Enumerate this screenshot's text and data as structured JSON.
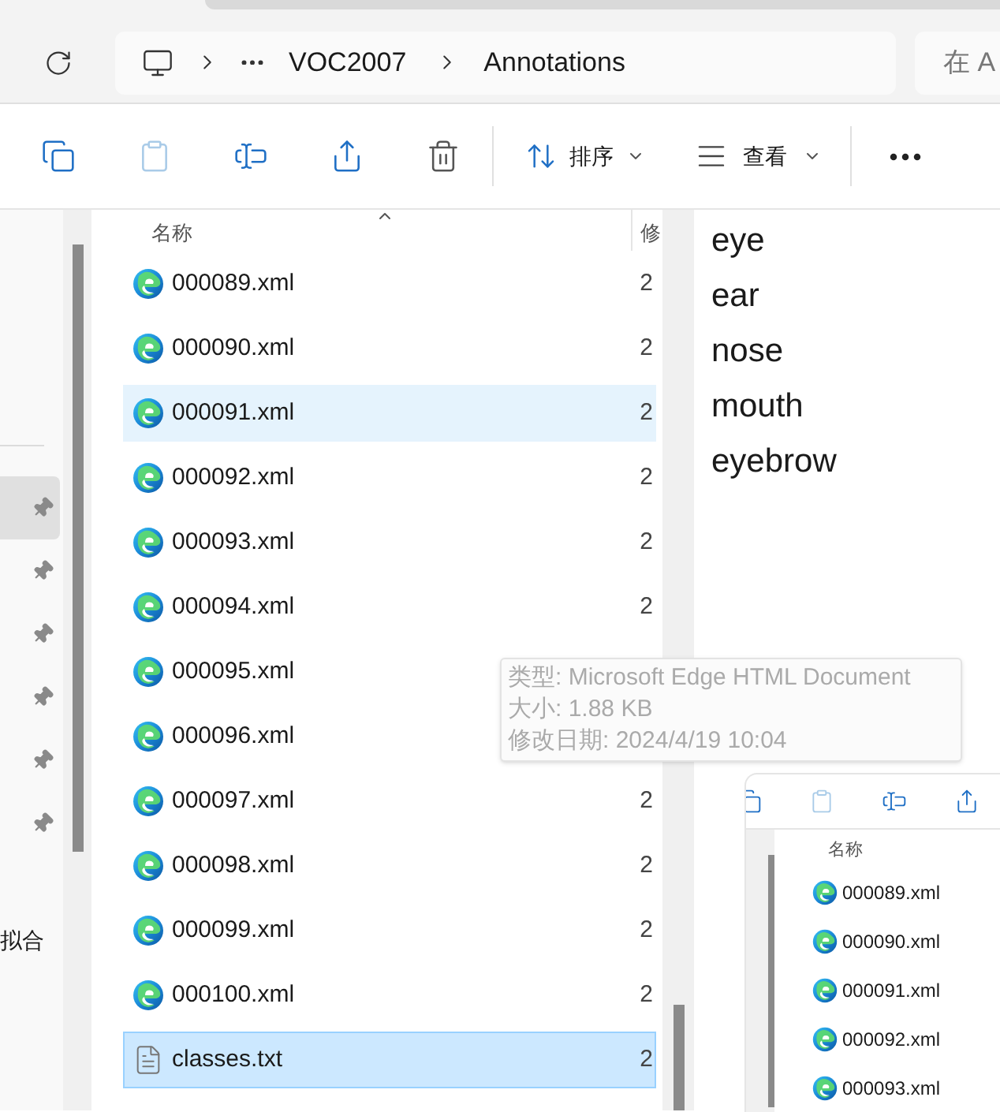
{
  "address_bar": {
    "breadcrumbs": [
      "VOC2007",
      "Annotations"
    ]
  },
  "search": {
    "placeholder": "在 A"
  },
  "toolbar": {
    "buttons": [
      {
        "kind": "copy",
        "disabled": false
      },
      {
        "kind": "paste",
        "disabled": true
      },
      {
        "kind": "rename",
        "disabled": false
      },
      {
        "kind": "share",
        "disabled": false
      },
      {
        "kind": "delete",
        "disabled": false
      }
    ],
    "sort": {
      "label": "排序"
    },
    "view": {
      "label": "查看"
    }
  },
  "nav": {
    "items": [
      {
        "selected": true
      },
      {
        "selected": false
      },
      {
        "selected": false
      },
      {
        "selected": false
      },
      {
        "selected": false
      },
      {
        "selected": false
      }
    ],
    "label": "拟合"
  },
  "file_list": {
    "columns": [
      "名称",
      "修"
    ],
    "files": [
      {
        "name": "000089.xml",
        "kind": "xml",
        "date": "2",
        "hovered": false,
        "selected": false
      },
      {
        "name": "000090.xml",
        "kind": "xml",
        "date": "2",
        "hovered": false,
        "selected": false
      },
      {
        "name": "000091.xml",
        "kind": "xml",
        "date": "2",
        "hovered": true,
        "selected": false
      },
      {
        "name": "000092.xml",
        "kind": "xml",
        "date": "2",
        "hovered": false,
        "selected": false
      },
      {
        "name": "000093.xml",
        "kind": "xml",
        "date": "2",
        "hovered": false,
        "selected": false
      },
      {
        "name": "000094.xml",
        "kind": "xml",
        "date": "2",
        "hovered": false,
        "selected": false
      },
      {
        "name": "000095.xml",
        "kind": "xml",
        "hovered": false,
        "selected": false
      },
      {
        "name": "000096.xml",
        "kind": "xml",
        "hovered": false,
        "selected": false
      },
      {
        "name": "000097.xml",
        "kind": "xml",
        "date": "2",
        "hovered": false,
        "selected": false
      },
      {
        "name": "000098.xml",
        "kind": "xml",
        "date": "2",
        "hovered": false,
        "selected": false
      },
      {
        "name": "000099.xml",
        "kind": "xml",
        "date": "2",
        "hovered": false,
        "selected": false
      },
      {
        "name": "000100.xml",
        "kind": "xml",
        "date": "2",
        "hovered": false,
        "selected": false
      },
      {
        "name": "classes.txt",
        "kind": "txt",
        "date": "2",
        "hovered": false,
        "selected": true
      }
    ]
  },
  "text_pane": {
    "lines": [
      "eye",
      "ear",
      "nose",
      "mouth",
      "eyebrow"
    ]
  },
  "tooltip": {
    "lines": [
      "类型: Microsoft Edge HTML Document",
      "大小: 1.88 KB",
      "修改日期: 2024/4/19 10:04"
    ]
  },
  "inset": {
    "toolbar": [
      {
        "kind": "copy",
        "disabled": false
      },
      {
        "kind": "paste",
        "disabled": true
      },
      {
        "kind": "rename",
        "disabled": false
      },
      {
        "kind": "share",
        "disabled": false
      }
    ],
    "column": "名称",
    "files": [
      "000089.xml",
      "000090.xml",
      "000091.xml",
      "000092.xml",
      "000093.xml"
    ]
  }
}
